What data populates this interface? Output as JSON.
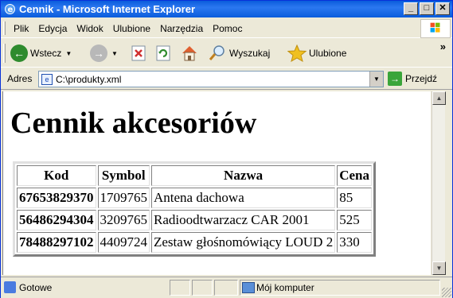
{
  "window": {
    "title": "Cennik - Microsoft Internet Explorer",
    "buttons": [
      "_",
      "□",
      "✕"
    ]
  },
  "menu": {
    "items": [
      "Plik",
      "Edycja",
      "Widok",
      "Ulubione",
      "Narzędzia",
      "Pomoc"
    ]
  },
  "toolbar": {
    "back_label": "Wstecz",
    "search_label": "Wyszukaj",
    "favorites_label": "Ulubione",
    "more": "»"
  },
  "address": {
    "label": "Adres",
    "value": "C:\\produkty.xml",
    "go_label": "Przejdź"
  },
  "page": {
    "heading": "Cennik akcesoriów",
    "columns": [
      "Kod",
      "Symbol",
      "Nazwa",
      "Cena"
    ],
    "rows": [
      {
        "kod": "67653829370",
        "symbol": "1709765",
        "nazwa": "Antena dachowa",
        "cena": "85"
      },
      {
        "kod": "56486294304",
        "symbol": "3209765",
        "nazwa": "Radioodtwarzacz CAR 2001",
        "cena": "525"
      },
      {
        "kod": "78488297102",
        "symbol": "4409724",
        "nazwa": "Zestaw głośnomówiący LOUD 2",
        "cena": "330"
      }
    ]
  },
  "status": {
    "text": "Gotowe",
    "zone": "Mój komputer"
  },
  "icons": [
    "ie-icon",
    "windows-logo-icon",
    "back-icon",
    "forward-icon",
    "stop-icon",
    "refresh-icon",
    "home-icon",
    "search-icon",
    "favorites-icon",
    "page-icon",
    "go-icon",
    "computer-icon"
  ],
  "colors": {
    "titlebar": "#0a5cdc",
    "back": "#2e8b2e",
    "stop": "#d03030",
    "favorites": "#f0c020"
  }
}
